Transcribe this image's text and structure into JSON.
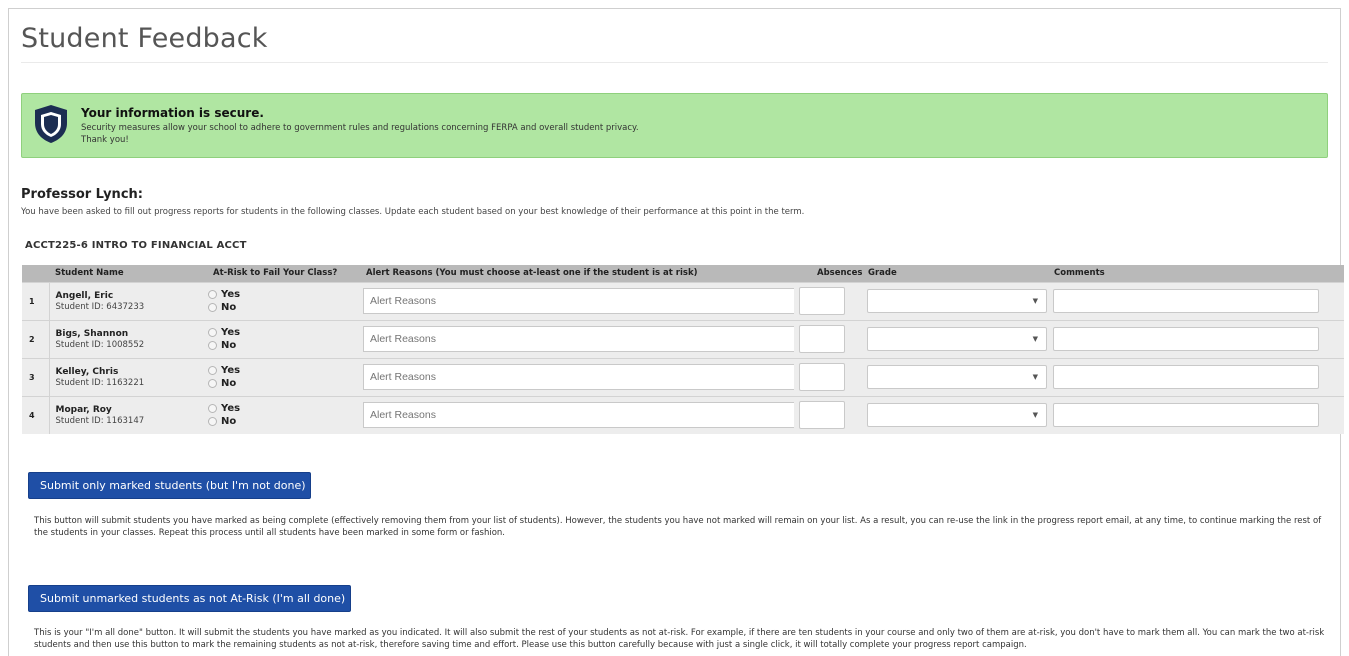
{
  "page": {
    "title": "Student Feedback"
  },
  "security": {
    "icon": "shield-icon",
    "title": "Your information is secure.",
    "line1": "Security measures allow your school to adhere to government rules and regulations concerning FERPA and overall student privacy.",
    "line2": "Thank you!"
  },
  "professor": {
    "name": "Professor Lynch:",
    "description": "You have been asked to fill out progress reports for students in the following classes. Update each student based on your best knowledge of their performance at this point in the term."
  },
  "course": {
    "title": "ACCT225-6 INTRO TO FINANCIAL ACCT",
    "columns": {
      "student_name": "Student Name",
      "at_risk": "At-Risk to Fail Your Class?",
      "alert_reasons": "Alert Reasons (You must choose at-least one if the student is at risk)",
      "absences": "Absences",
      "grade": "Grade",
      "comments": "Comments"
    },
    "students": [
      {
        "index": "1",
        "name": "Angell, Eric",
        "student_id": "Student ID: 6437233",
        "yes_label": "Yes",
        "no_label": "No",
        "alert_placeholder": "Alert Reasons",
        "absences": "",
        "grade": "",
        "comments": ""
      },
      {
        "index": "2",
        "name": "Bigs, Shannon",
        "student_id": "Student ID: 1008552",
        "yes_label": "Yes",
        "no_label": "No",
        "alert_placeholder": "Alert Reasons",
        "absences": "",
        "grade": "",
        "comments": ""
      },
      {
        "index": "3",
        "name": "Kelley, Chris",
        "student_id": "Student ID: 1163221",
        "yes_label": "Yes",
        "no_label": "No",
        "alert_placeholder": "Alert Reasons",
        "absences": "",
        "grade": "",
        "comments": ""
      },
      {
        "index": "4",
        "name": "Mopar, Roy",
        "student_id": "Student ID: 1163147",
        "yes_label": "Yes",
        "no_label": "No",
        "alert_placeholder": "Alert Reasons",
        "absences": "",
        "grade": "",
        "comments": ""
      }
    ]
  },
  "actions": {
    "submit_marked_label": "Submit only marked students (but I'm not done)",
    "submit_marked_note": "This button will submit students you have marked as being complete (effectively removing them from your list of students). However, the students you have not marked will remain on your list. As a result, you can re-use the link in the progress report email, at any time, to continue marking the rest of the students in your classes. Repeat this process until all students have been marked in some form or fashion.",
    "submit_all_label": "Submit unmarked students as not At-Risk (I'm all done)",
    "submit_all_note": "This is your \"I'm all done\" button. It will submit the students you have marked as you indicated. It will also submit the rest of your students as not at-risk. For example, if there are ten students in your course and only two of them are at-risk, you don't have to mark them all. You can mark the two at-risk students and then use this button to mark the remaining students as not at-risk, therefore saving time and effort. Please use this button carefully because with just a single click, it will totally complete your progress report campaign."
  },
  "colors": {
    "secure_bg": "#b0e6a2",
    "button_bg": "#1f4fa6",
    "header_bg": "#b9b9b9",
    "row_bg": "#ededed"
  }
}
